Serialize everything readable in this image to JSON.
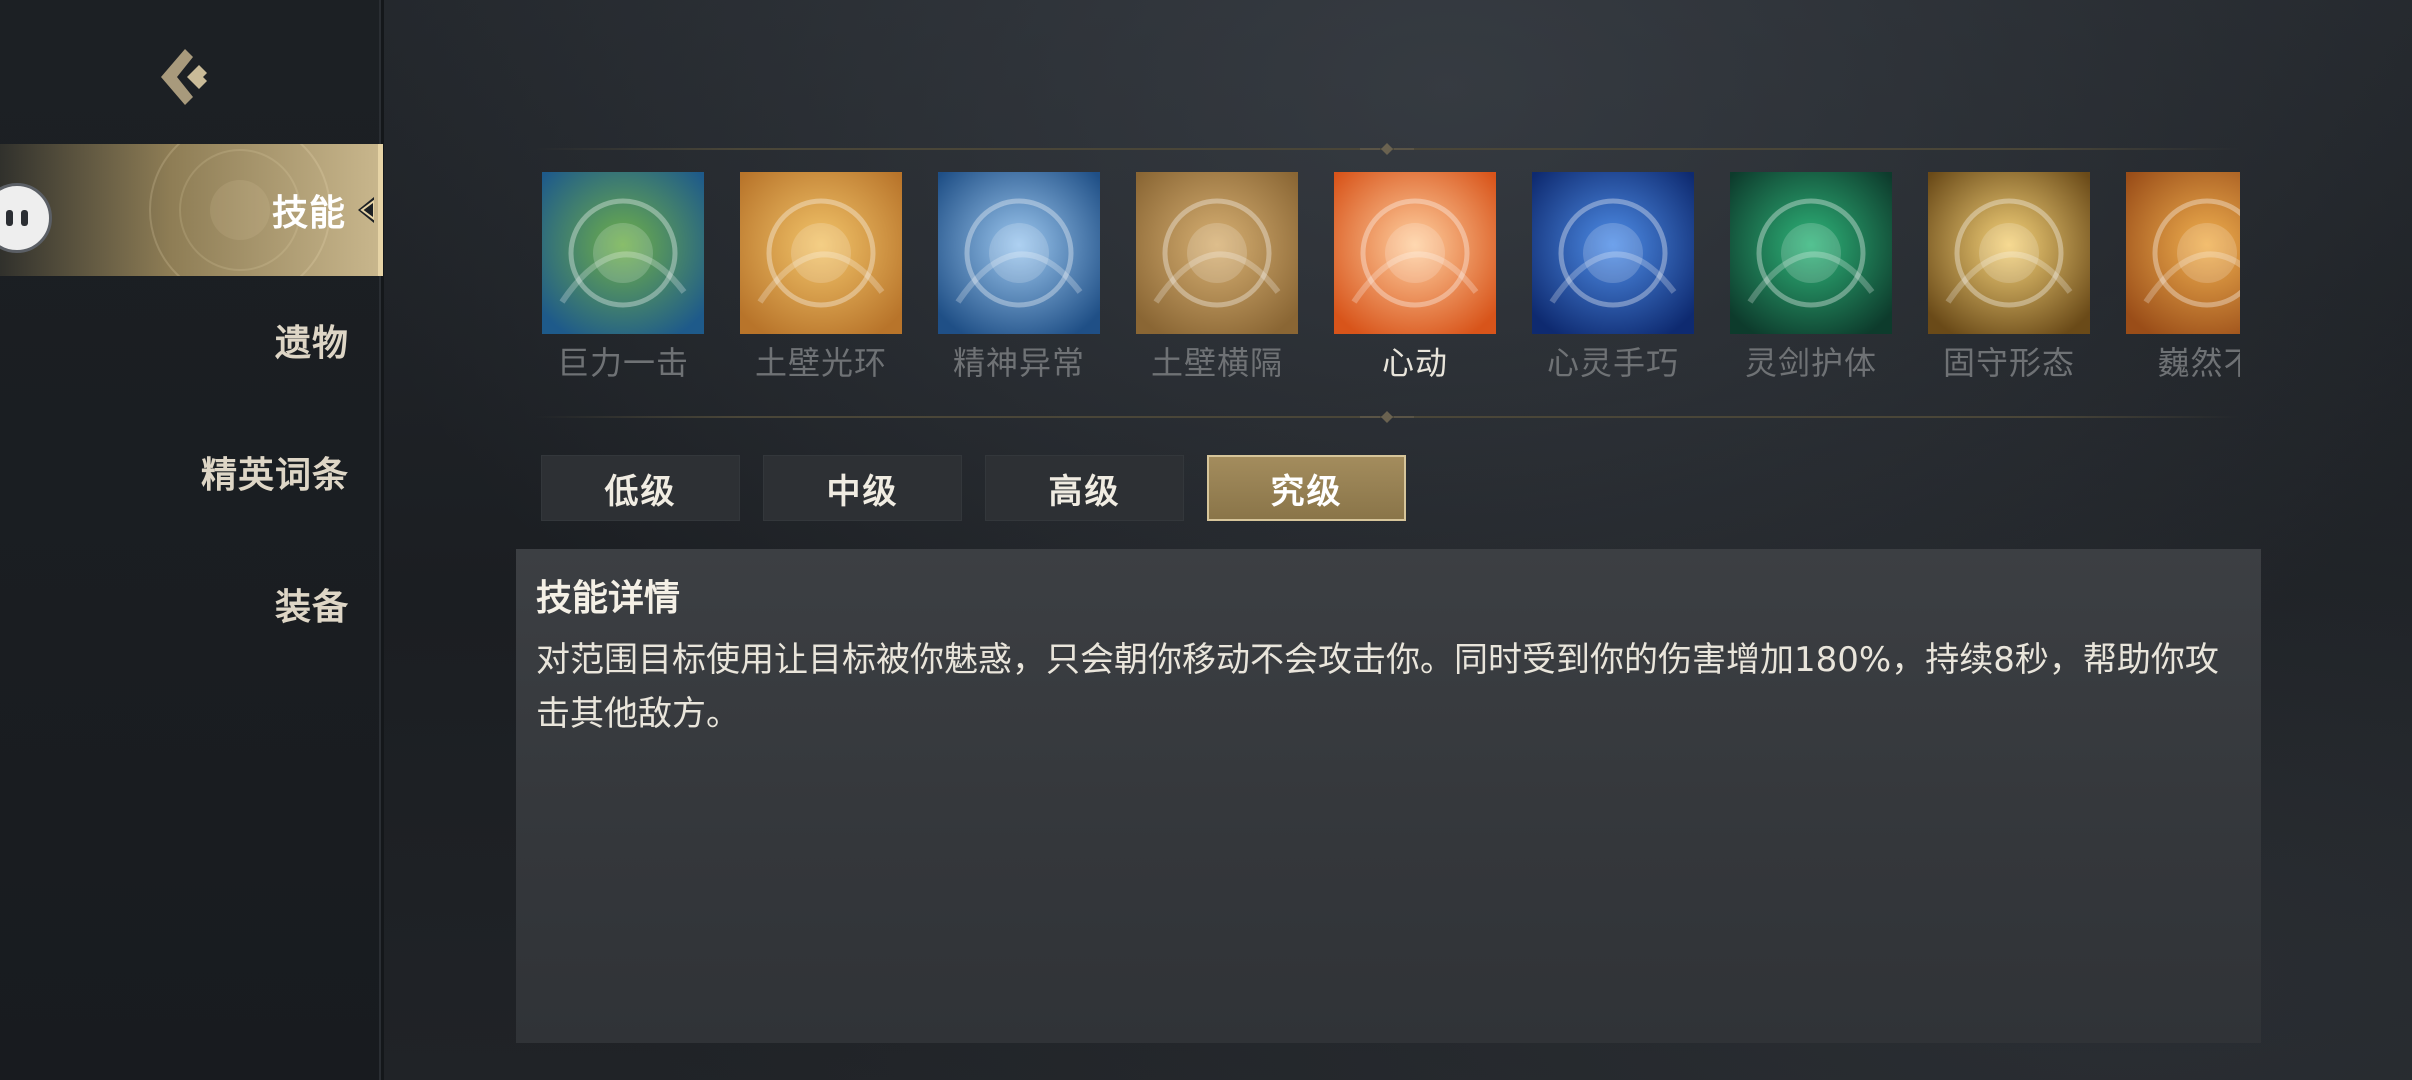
{
  "nav": {
    "items": [
      {
        "label": "技能",
        "active": true
      },
      {
        "label": "遗物",
        "active": false
      },
      {
        "label": "精英词条",
        "active": false
      },
      {
        "label": "装备",
        "active": false
      }
    ]
  },
  "skills": [
    {
      "name": "巨力一击",
      "icon": "giant-strike-icon",
      "selected": false,
      "palette": [
        "#1e5a8a",
        "#6fb04a"
      ]
    },
    {
      "name": "土壁光环",
      "icon": "earth-wall-aura-icon",
      "selected": false,
      "palette": [
        "#b8742a",
        "#f2c46a"
      ]
    },
    {
      "name": "精神异常",
      "icon": "mental-anomaly-icon",
      "selected": false,
      "palette": [
        "#1f4f86",
        "#9cc7ef"
      ]
    },
    {
      "name": "土壁横隔",
      "icon": "earth-wall-barrier-icon",
      "selected": false,
      "palette": [
        "#8a6634",
        "#d7b073"
      ]
    },
    {
      "name": "心动",
      "icon": "heartbeat-icon",
      "selected": true,
      "palette": [
        "#d8541a",
        "#ffd0a0"
      ]
    },
    {
      "name": "心灵手巧",
      "icon": "dexterity-icon",
      "selected": false,
      "palette": [
        "#0e2a70",
        "#4f8ee8"
      ]
    },
    {
      "name": "灵剑护体",
      "icon": "spirit-sword-guard-icon",
      "selected": false,
      "palette": [
        "#0d3b2c",
        "#2fb57a"
      ]
    },
    {
      "name": "固守形态",
      "icon": "defensive-stance-icon",
      "selected": false,
      "palette": [
        "#6a4a18",
        "#f5d27a"
      ]
    },
    {
      "name": "巍然不",
      "icon": "steadfast-icon",
      "selected": false,
      "palette": [
        "#9a4d18",
        "#f0b050"
      ]
    }
  ],
  "tiers": [
    {
      "label": "低级",
      "active": false
    },
    {
      "label": "中级",
      "active": false
    },
    {
      "label": "高级",
      "active": false
    },
    {
      "label": "究级",
      "active": true
    }
  ],
  "detail": {
    "title": "技能详情",
    "description": "对范围目标使用让目标被你魅惑，只会朝你移动不会攻击你。同时受到你的伤害增加180%，持续8秒，帮助你攻击其他敌方。"
  },
  "colors": {
    "accent_gold": "#a38c5d",
    "selected_text": "#e8e4da",
    "muted_text": "#6f7275"
  }
}
